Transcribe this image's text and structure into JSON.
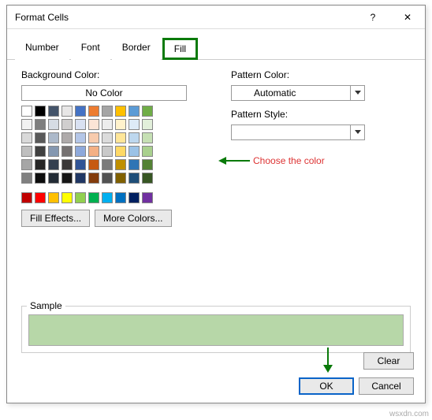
{
  "dialog": {
    "title": "Format Cells",
    "help_icon": "?",
    "close_icon": "✕"
  },
  "tabs": {
    "items": [
      "Number",
      "Font",
      "Border",
      "Fill"
    ],
    "active": "Fill"
  },
  "fill": {
    "background_label": "Background Color:",
    "no_color": "No Color",
    "fill_effects": "Fill Effects...",
    "more_colors": "More Colors...",
    "pattern_color_label": "Pattern Color:",
    "pattern_color_value": "Automatic",
    "pattern_style_label": "Pattern Style:",
    "pattern_style_value": ""
  },
  "palette": {
    "row1": [
      "#ffffff",
      "#000000",
      "#44546a",
      "#e7e6e6",
      "#4472c4",
      "#ed7d31",
      "#a5a5a5",
      "#ffc000",
      "#5b9bd5",
      "#70ad47"
    ],
    "row2": [
      "#f2f2f2",
      "#7f7f7f",
      "#d6dce4",
      "#d0cece",
      "#d9e1f2",
      "#fce4d6",
      "#ededed",
      "#fff2cc",
      "#ddebf7",
      "#e2efda"
    ],
    "row3": [
      "#d9d9d9",
      "#595959",
      "#acb9ca",
      "#aeaaaa",
      "#b4c6e7",
      "#f8cbad",
      "#dbdbdb",
      "#ffe699",
      "#bdd7ee",
      "#c6e0b4"
    ],
    "row4": [
      "#bfbfbf",
      "#404040",
      "#8497b0",
      "#757171",
      "#8ea9db",
      "#f4b084",
      "#c9c9c9",
      "#ffd966",
      "#9bc2e6",
      "#a9d08e"
    ],
    "row5": [
      "#a6a6a6",
      "#262626",
      "#333f4f",
      "#3a3838",
      "#305496",
      "#c65911",
      "#7b7b7b",
      "#bf8f00",
      "#2f75b5",
      "#548235"
    ],
    "row6": [
      "#808080",
      "#0d0d0d",
      "#222b35",
      "#161616",
      "#203764",
      "#833c0c",
      "#525252",
      "#806000",
      "#1f4e78",
      "#375623"
    ],
    "standard": [
      "#c00000",
      "#ff0000",
      "#ffc000",
      "#ffff00",
      "#92d050",
      "#00b050",
      "#00b0f0",
      "#0070c0",
      "#002060",
      "#7030a0"
    ]
  },
  "annotation": {
    "text": "Choose the color"
  },
  "sample": {
    "label": "Sample",
    "color": "#b7d7a8"
  },
  "buttons": {
    "clear": "Clear",
    "ok": "OK",
    "cancel": "Cancel"
  },
  "watermark": "wsxdn.com"
}
